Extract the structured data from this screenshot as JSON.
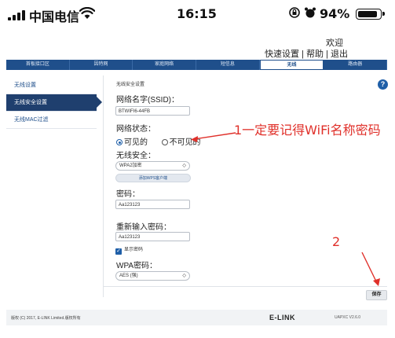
{
  "status_bar": {
    "carrier": "中国电信",
    "time": "16:15",
    "battery": "94%",
    "battery_level": 0.94,
    "icons": [
      "signal-icon",
      "wifi-icon",
      "rotation-lock-icon",
      "alarm-icon",
      "battery-icon"
    ]
  },
  "header": {
    "welcome": "欢迎",
    "links": [
      "快速设置",
      "帮助",
      "退出"
    ],
    "separator": " | "
  },
  "nav": {
    "tabs": [
      "首板接口区",
      "因特网",
      "家庭网络",
      "短信息",
      "无线",
      "路由器"
    ],
    "active_index": 4
  },
  "sidebar": {
    "items": [
      "无线设置",
      "无线安全设置",
      "无线MAC过滤"
    ],
    "active_index": 1
  },
  "main": {
    "section_title": "无线安全设置",
    "ssid_label": "网络名字(SSID)：",
    "ssid_value": "BTWIFI6-44FB",
    "network_status_label": "网络状态：",
    "visible_option": "可见的",
    "invisible_option": "不可见的",
    "visibility_selected": "可见的",
    "security_label": "无线安全：",
    "security_value": "WPA2加密",
    "wps_button": "添加WPS客户端",
    "password_label": "密码：",
    "password_value": "Aa123123",
    "reenter_label": "重新输入密码：",
    "reenter_value": "Aa123123",
    "show_password_label": "显示密码",
    "show_password_checked": true,
    "wpa_label": "WPA密码：",
    "wpa_value": "AES (强)",
    "save_button": "保存"
  },
  "footer": {
    "copyright": "版权 (C) 2017, E-LINK Limited.版权所有",
    "brand": "E-LINK",
    "version": "UAPXC V2.6.0"
  },
  "annotations": {
    "note1": "1一定要记得WiFi名称密码",
    "note2": "2",
    "color": "#e0302a"
  }
}
